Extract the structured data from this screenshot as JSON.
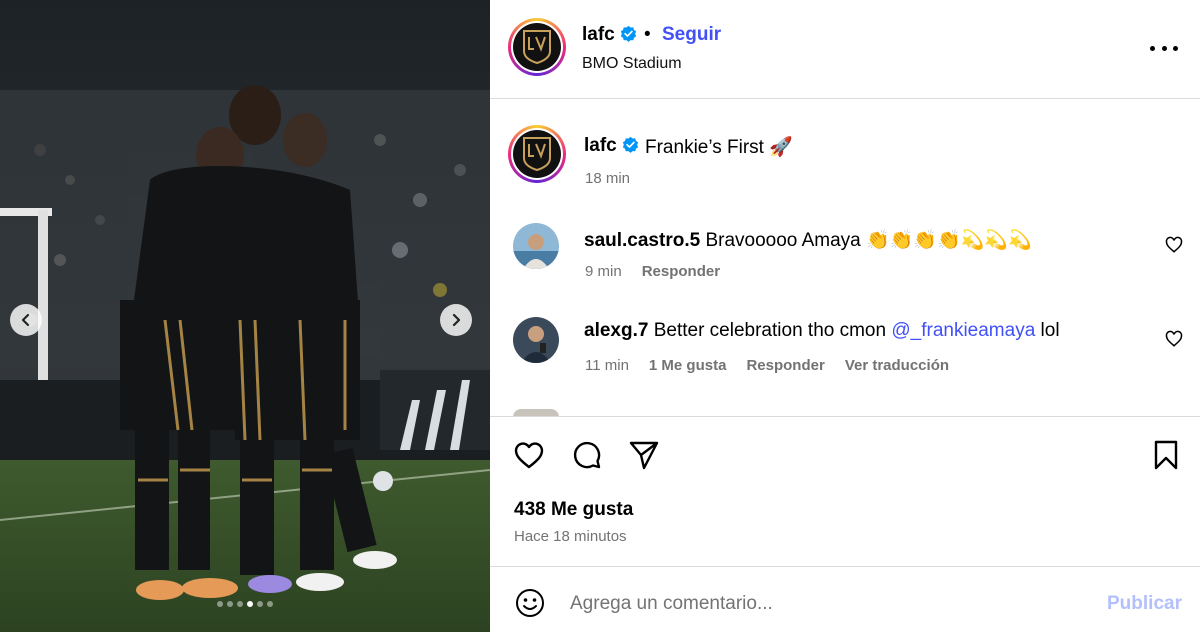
{
  "post": {
    "username": "lafc",
    "follow_label": "Seguir",
    "separator": "•",
    "location": "BMO Stadium",
    "avatar_logo": "LAFC",
    "caption": {
      "username": "lafc",
      "text": "Frankie’s First 🚀",
      "time": "18 min"
    }
  },
  "comments": [
    {
      "username": "saul.castro.5",
      "text": " Bravooooo Amaya 👏👏👏👏💫💫💫",
      "time": "9 min",
      "likes": "",
      "reply": "Responder",
      "translate": ""
    },
    {
      "username": "alexg.7",
      "text": " Better celebration tho cmon ",
      "mention": "@_frankieamaya",
      "text_after": " lol",
      "time": "11 min",
      "likes": "1 Me gusta",
      "reply": "Responder",
      "translate": "Ver traducción"
    }
  ],
  "actions": {
    "likes": "438 Me gusta",
    "posted": "Hace 18 minutos"
  },
  "composer": {
    "placeholder": "Agrega un comentario...",
    "publish_label": "Publicar"
  },
  "carousel": {
    "slide_count": 6,
    "active_index": 3
  },
  "icons": {
    "verified": "verified-badge-icon",
    "more": "more-options-icon",
    "like": "heart-icon",
    "comment": "comment-icon",
    "share": "send-icon",
    "save": "bookmark-icon",
    "emoji": "emoji-icon",
    "prev": "chevron-left-icon",
    "next": "chevron-right-icon"
  },
  "colors": {
    "link": "#4150f7",
    "publish_disabled": "#b3c0fb",
    "muted": "#737373",
    "verified": "#0095f6"
  }
}
